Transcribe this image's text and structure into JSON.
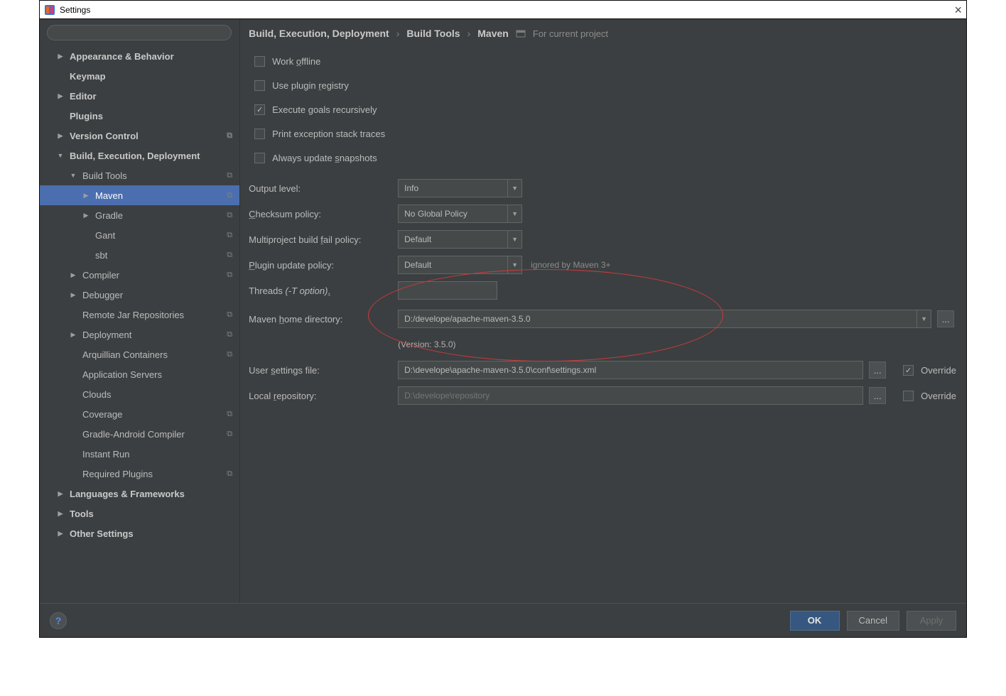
{
  "window": {
    "title": "Settings"
  },
  "search": {
    "placeholder": ""
  },
  "tree": [
    {
      "indent": 0,
      "arrow": "right",
      "label": "Appearance & Behavior",
      "bold": true,
      "copy": false
    },
    {
      "indent": 0,
      "arrow": "none",
      "label": "Keymap",
      "bold": true,
      "copy": false
    },
    {
      "indent": 0,
      "arrow": "right",
      "label": "Editor",
      "bold": true,
      "copy": false
    },
    {
      "indent": 0,
      "arrow": "none",
      "label": "Plugins",
      "bold": true,
      "copy": false
    },
    {
      "indent": 0,
      "arrow": "right",
      "label": "Version Control",
      "bold": true,
      "copy": true
    },
    {
      "indent": 0,
      "arrow": "down",
      "label": "Build, Execution, Deployment",
      "bold": true,
      "copy": false
    },
    {
      "indent": 1,
      "arrow": "down",
      "label": "Build Tools",
      "bold": false,
      "copy": true
    },
    {
      "indent": 2,
      "arrow": "right",
      "label": "Maven",
      "bold": false,
      "copy": true,
      "selected": true
    },
    {
      "indent": 2,
      "arrow": "right",
      "label": "Gradle",
      "bold": false,
      "copy": true
    },
    {
      "indent": 2,
      "arrow": "none",
      "label": "Gant",
      "bold": false,
      "copy": true
    },
    {
      "indent": 2,
      "arrow": "none",
      "label": "sbt",
      "bold": false,
      "copy": true
    },
    {
      "indent": 1,
      "arrow": "right",
      "label": "Compiler",
      "bold": false,
      "copy": true
    },
    {
      "indent": 1,
      "arrow": "right",
      "label": "Debugger",
      "bold": false,
      "copy": false
    },
    {
      "indent": 1,
      "arrow": "none",
      "label": "Remote Jar Repositories",
      "bold": false,
      "copy": true
    },
    {
      "indent": 1,
      "arrow": "right",
      "label": "Deployment",
      "bold": false,
      "copy": true
    },
    {
      "indent": 1,
      "arrow": "none",
      "label": "Arquillian Containers",
      "bold": false,
      "copy": true
    },
    {
      "indent": 1,
      "arrow": "none",
      "label": "Application Servers",
      "bold": false,
      "copy": false
    },
    {
      "indent": 1,
      "arrow": "none",
      "label": "Clouds",
      "bold": false,
      "copy": false
    },
    {
      "indent": 1,
      "arrow": "none",
      "label": "Coverage",
      "bold": false,
      "copy": true
    },
    {
      "indent": 1,
      "arrow": "none",
      "label": "Gradle-Android Compiler",
      "bold": false,
      "copy": true
    },
    {
      "indent": 1,
      "arrow": "none",
      "label": "Instant Run",
      "bold": false,
      "copy": false
    },
    {
      "indent": 1,
      "arrow": "none",
      "label": "Required Plugins",
      "bold": false,
      "copy": true
    },
    {
      "indent": 0,
      "arrow": "right",
      "label": "Languages & Frameworks",
      "bold": true,
      "copy": false
    },
    {
      "indent": 0,
      "arrow": "right",
      "label": "Tools",
      "bold": true,
      "copy": false
    },
    {
      "indent": 0,
      "arrow": "right",
      "label": "Other Settings",
      "bold": true,
      "copy": false
    }
  ],
  "crumbs": {
    "a": "Build, Execution, Deployment",
    "b": "Build Tools",
    "c": "Maven",
    "proj": "For current project"
  },
  "checks": {
    "work_offline": "Work offline",
    "work_offline_u": "o",
    "plugin_reg": "Use plugin registry",
    "plugin_reg_u": "r",
    "exec_goals": "Execute goals recursively",
    "print_ex": "Print exception stack traces",
    "always_update": "Always update snapshots",
    "always_update_u": "s"
  },
  "labels": {
    "output_level": "Output level:",
    "checksum": "Checksum policy:",
    "checksum_u": "C",
    "multiproj": "Multiproject build fail policy:",
    "multiproj_u": "f",
    "plugin_update": "Plugin update policy:",
    "plugin_update_u": "P",
    "threads_pre": "Threads ",
    "threads_it": "(-T option)",
    "threads_u": ".",
    "maven_home": "Maven home directory:",
    "maven_home_u": "h",
    "user_settings": "User settings file:",
    "user_settings_u": "s",
    "local_repo": "Local repository:",
    "local_repo_u": "r",
    "override": "Override"
  },
  "values": {
    "output_level": "Info",
    "checksum": "No Global Policy",
    "multiproj": "Default",
    "plugin_update": "Default",
    "plugin_update_note": "ignored by Maven 3+",
    "threads": "",
    "maven_home": "D:/develope/apache-maven-3.5.0",
    "maven_version": "(Version: 3.5.0)",
    "user_settings": "D:\\develope\\apache-maven-3.5.0\\conf\\settings.xml",
    "local_repo": "D:\\develope\\repository",
    "override_user": true,
    "override_local": false
  },
  "buttons": {
    "ok": "OK",
    "cancel": "Cancel",
    "apply": "Apply"
  }
}
